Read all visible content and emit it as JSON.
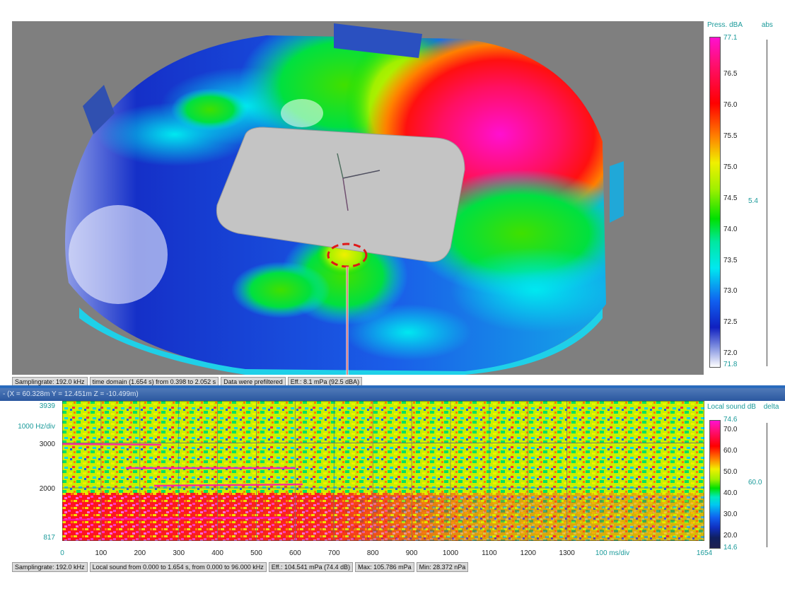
{
  "top_panel": {
    "colorbar_title": "Press. dBA",
    "colorbar_mode": "abs",
    "colorbar_max": "77.1",
    "colorbar_min": "71.8",
    "colorbar_ticks": [
      "76.5",
      "76.0",
      "75.5",
      "75.0",
      "74.5",
      "74.0",
      "73.5",
      "73.0",
      "72.5",
      "72.0"
    ],
    "side_value": "5.4",
    "status": {
      "samplingrate": "Samplingrate: 192.0 kHz",
      "time_domain": "time domain (1.654 s) from 0.398 to 2.052 s",
      "prefiltered": "Data were prefiltered",
      "eff": "Eff.: 8.1 mPa (92.5 dBA)"
    }
  },
  "cursor_readout": "- (X = 60.328m Y = 12.451m Z = -10.499m)",
  "bottom_panel": {
    "y_top": "3939",
    "y_scale": "1000 Hz/div",
    "y_ticks": [
      "3000",
      "2000"
    ],
    "y_bottom": "817",
    "x_scale": "100 ms/div",
    "colorbar_title": "Local sound dB",
    "colorbar_mode": "delta",
    "colorbar_max": "74.6",
    "colorbar_min": "14.6",
    "colorbar_ticks": [
      "70.0",
      "60.0",
      "50.0",
      "40.0",
      "30.0",
      "20.0"
    ],
    "side_value": "60.0",
    "status": {
      "samplingrate": "Samplingrate: 192.0 kHz",
      "local_sound": "Local sound from 0.000 to 1.654 s, from 0.000 to 96.000 kHz",
      "eff": "Eff.: 104.541 mPa (74.4 dB)",
      "max": "Max: 105.786 mPa",
      "min": "Min: 28.372 nPa"
    }
  },
  "chart_data": [
    {
      "type": "heatmap",
      "title": "",
      "colorbar_label": "Press. dBA",
      "colorbar_range": [
        71.8,
        77.1
      ],
      "colorbar_ticks": [
        72.0,
        72.5,
        73.0,
        73.5,
        74.0,
        74.5,
        75.0,
        75.5,
        76.0,
        76.5
      ],
      "colormap": [
        "#ffffff",
        "#1020c0",
        "#1060f0",
        "#00e8f0",
        "#00e000",
        "#f0f000",
        "#ff8000",
        "#ff0000",
        "#ff10d0"
      ]
    },
    {
      "type": "heatmap",
      "title": "",
      "xlabel": "100 ms/div",
      "ylabel": "1000 Hz/div",
      "xlim": [
        0,
        1654
      ],
      "ylim": [
        817,
        3939
      ],
      "x_ticks": [
        0,
        100,
        200,
        300,
        400,
        500,
        600,
        700,
        800,
        900,
        1000,
        1100,
        1200,
        1300,
        1654
      ],
      "y_ticks": [
        817,
        2000,
        3000,
        3939
      ],
      "colorbar_label": "Local sound dB",
      "colorbar_range": [
        14.6,
        74.6
      ],
      "colorbar_ticks": [
        20.0,
        30.0,
        40.0,
        50.0,
        60.0,
        70.0
      ],
      "colormap": [
        "#1a2a80",
        "#1060f0",
        "#00e8f0",
        "#00e000",
        "#f0f000",
        "#ff8000",
        "#ff0000",
        "#ff10d0"
      ]
    }
  ]
}
